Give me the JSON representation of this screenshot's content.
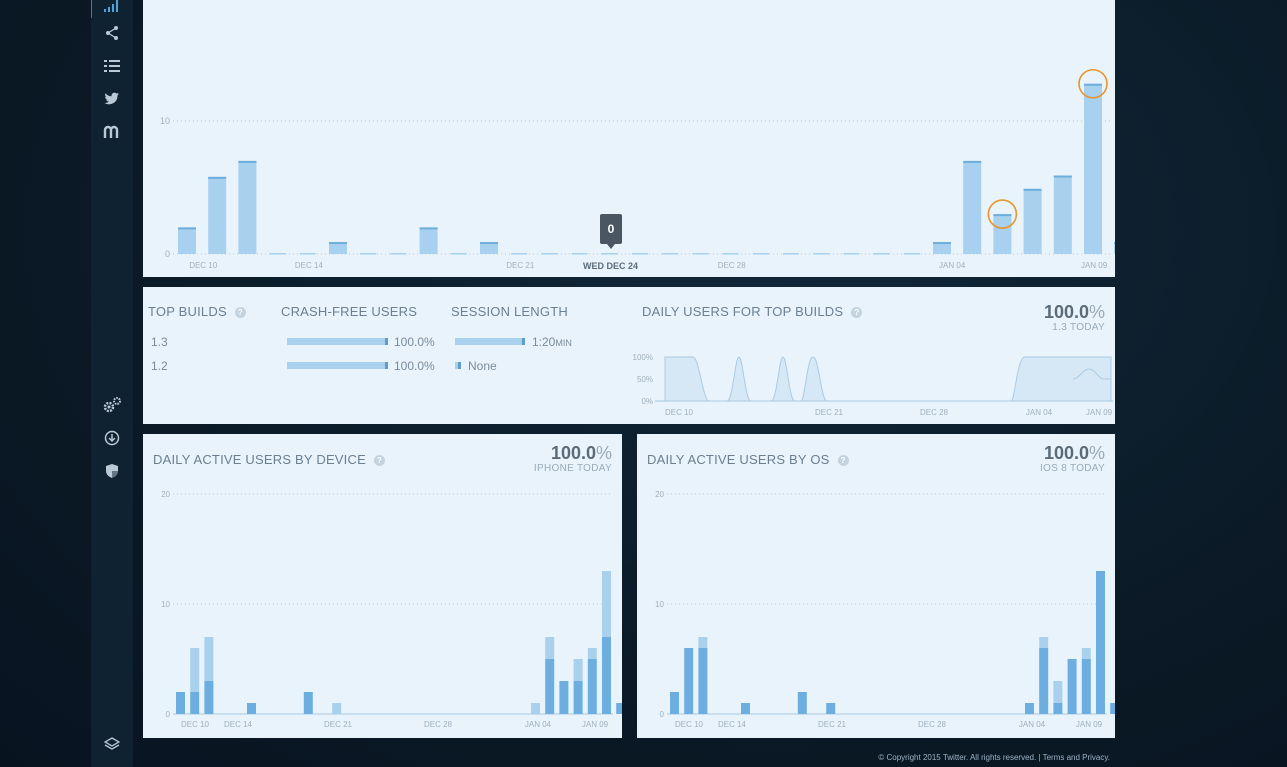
{
  "sidebar": {
    "icons": [
      "signal-bars-icon",
      "share-nodes-icon",
      "list-icon",
      "twitter-bird-icon",
      "m-logo-icon",
      "gears-icon",
      "download-circle-icon",
      "shield-icon",
      "layers-icon"
    ]
  },
  "top_chart": {
    "tooltip_value": "0",
    "hover_label": "WED DEC 24",
    "x_ticks": [
      "DEC 10",
      "DEC 14",
      "DEC 21",
      "DEC 28",
      "JAN 04",
      "JAN 09"
    ],
    "y_ticks": [
      "0",
      "10"
    ],
    "chart_data": {
      "type": "bar",
      "ylim": [
        0,
        14
      ],
      "values": [
        2,
        5.8,
        7,
        0,
        0,
        0.9,
        0,
        0,
        2,
        0,
        0.9,
        0,
        0,
        0,
        0,
        0,
        0,
        0,
        0,
        0,
        0,
        0,
        0,
        0,
        0,
        0.9,
        7,
        3,
        4.9,
        5.9,
        12.8,
        0.9
      ],
      "highlighted_indices": [
        27,
        30
      ],
      "hover_index": 14
    }
  },
  "builds": {
    "title": "TOP BUILDS",
    "crash_header": "CRASH-FREE USERS",
    "session_header": "SESSION LENGTH",
    "rows": [
      {
        "version": "1.3",
        "crash_free": "100.0%",
        "crash_fraction": 1.0,
        "session": "1:20",
        "session_unit": "MIN",
        "session_fraction": 1.0
      },
      {
        "version": "1.2",
        "crash_free": "100.0%",
        "crash_fraction": 1.0,
        "session": "None",
        "session_unit": "",
        "session_fraction": 0.04
      }
    ]
  },
  "daily_top_builds": {
    "title": "DAILY USERS FOR TOP BUILDS",
    "big_value": "100.0",
    "big_pct": "%",
    "sub": "1.3 TODAY",
    "y_ticks": [
      "100%",
      "50%",
      "0%"
    ],
    "x_ticks": [
      "DEC 10",
      "DEC 21",
      "DEC 28",
      "JAN 04",
      "JAN 09"
    ]
  },
  "by_device": {
    "title": "DAILY ACTIVE USERS BY DEVICE",
    "big_value": "100.0",
    "big_pct": "%",
    "sub": "IPHONE TODAY",
    "y_ticks": [
      "20",
      "10",
      "0"
    ],
    "x_ticks": [
      "DEC 10",
      "DEC 14",
      "DEC 21",
      "DEC 28",
      "JAN 04",
      "JAN 09"
    ],
    "chart_data": {
      "type": "bar",
      "ylim": [
        0,
        20
      ],
      "series": [
        {
          "values": [
            2,
            2,
            3,
            0,
            0,
            1,
            0,
            0,
            0,
            2,
            0,
            0,
            0,
            0,
            0,
            0,
            0,
            0,
            0,
            0,
            0,
            0,
            0,
            0,
            0,
            0,
            5,
            3,
            3,
            5,
            7,
            1
          ]
        },
        {
          "values": [
            0,
            4,
            4,
            0,
            0,
            0,
            0,
            0,
            0,
            0,
            0,
            1,
            0,
            0,
            0,
            0,
            0,
            0,
            0,
            0,
            0,
            0,
            0,
            0,
            0,
            1,
            2,
            0,
            2,
            1,
            6,
            0
          ]
        }
      ]
    }
  },
  "by_os": {
    "title": "DAILY ACTIVE USERS BY OS",
    "big_value": "100.0",
    "big_pct": "%",
    "sub": "IOS 8 TODAY",
    "y_ticks": [
      "20",
      "10",
      "0"
    ],
    "x_ticks": [
      "DEC 10",
      "DEC 14",
      "DEC 21",
      "DEC 28",
      "JAN 04",
      "JAN 09"
    ],
    "chart_data": {
      "type": "bar",
      "ylim": [
        0,
        20
      ],
      "series": [
        {
          "values": [
            2,
            6,
            6,
            0,
            0,
            1,
            0,
            0,
            0,
            2,
            0,
            1,
            0,
            0,
            0,
            0,
            0,
            0,
            0,
            0,
            0,
            0,
            0,
            0,
            0,
            1,
            6,
            1,
            5,
            5,
            13,
            1
          ]
        },
        {
          "values": [
            0,
            0,
            1,
            0,
            0,
            0,
            0,
            0,
            0,
            0,
            0,
            0,
            0,
            0,
            0,
            0,
            0,
            0,
            0,
            0,
            0,
            0,
            0,
            0,
            0,
            0,
            1,
            2,
            0,
            1,
            0,
            0
          ]
        }
      ]
    }
  },
  "footer": {
    "text": "© Copyright 2015 Twitter. All rights reserved. | Terms and Privacy."
  }
}
